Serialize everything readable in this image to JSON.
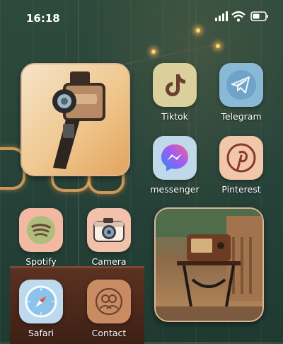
{
  "status_bar": {
    "time": "16:18"
  },
  "apps": [
    {
      "id": "tiktok",
      "label": "Tiktok",
      "icon": "tiktok-icon",
      "bg": "#d9d09b"
    },
    {
      "id": "telegram",
      "label": "Telegram",
      "icon": "telegram-icon",
      "bg": "#8ab9d8"
    },
    {
      "id": "messenger",
      "label": "messenger",
      "icon": "messenger-icon",
      "bg": "#bfd8ea"
    },
    {
      "id": "pinterest",
      "label": "Pinterest",
      "icon": "pinterest-icon",
      "bg": "#f1c7a9"
    },
    {
      "id": "spotify",
      "label": "Spotify",
      "icon": "spotify-icon",
      "bg": "#f2b9a2"
    },
    {
      "id": "camera",
      "label": "Camera",
      "icon": "camera-icon",
      "bg": "#f1c1ab"
    },
    {
      "id": "safari",
      "label": "Safari",
      "icon": "safari-icon",
      "bg": "#bcd9ee"
    },
    {
      "id": "contact",
      "label": "Contact",
      "icon": "contact-icon",
      "bg": "#c98c62"
    }
  ],
  "widgets": [
    {
      "id": "camera-photo",
      "icon": "film-camera-photo"
    },
    {
      "id": "vintage-photo",
      "icon": "vintage-radio-photo"
    }
  ],
  "colors": {
    "accent": "#d9b697",
    "text": "#ffffff"
  }
}
